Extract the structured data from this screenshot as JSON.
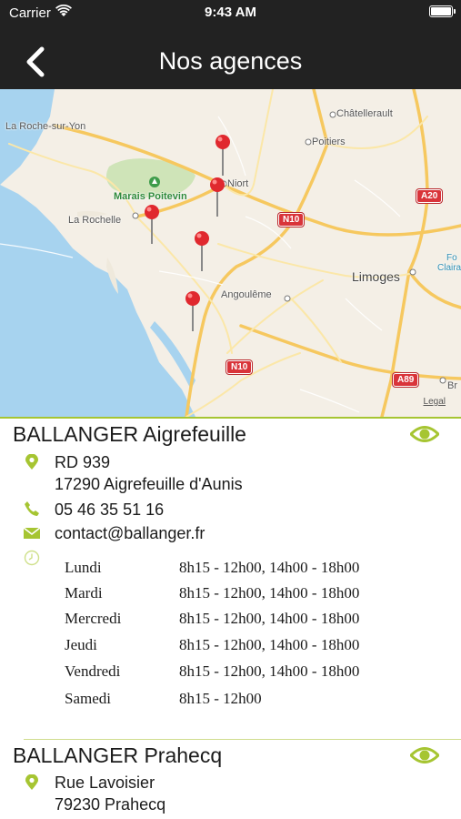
{
  "status_bar": {
    "carrier": "Carrier",
    "time": "9:43 AM"
  },
  "nav": {
    "title": "Nos agences",
    "back_icon": "chevron-left-icon"
  },
  "map": {
    "cities": {
      "la_roche_sur_yon": "La Roche-sur-Yon",
      "chatellerault": "Châtellerault",
      "poitiers": "Poitiers",
      "niort": "Niort",
      "marais_poitevin": "Marais Poitevin",
      "la_rochelle": "La Rochelle",
      "limoges": "Limoges",
      "angouleme": "Angoulême",
      "foret": "Fo",
      "claira": "Claira",
      "br": "Br"
    },
    "roads": {
      "a20": "A20",
      "n10_a": "N10",
      "n10_b": "N10",
      "a89": "A89"
    },
    "legal": "Legal",
    "pin_color": "#e0282e",
    "water_color": "#a7d3ef"
  },
  "accent_color": "#a6c532",
  "agencies": [
    {
      "name": "BALLANGER Aigrefeuille",
      "address_line1": "RD 939",
      "address_line2": "17290 Aigrefeuille d'Aunis",
      "phone": "05 46 35 51 16",
      "email": "contact@ballanger.fr",
      "hours": [
        {
          "day": "Lundi",
          "time": "8h15 - 12h00, 14h00 - 18h00"
        },
        {
          "day": "Mardi",
          "time": "8h15 - 12h00, 14h00 - 18h00"
        },
        {
          "day": "Mercredi",
          "time": "8h15 - 12h00, 14h00 - 18h00"
        },
        {
          "day": "Jeudi",
          "time": "8h15 - 12h00, 14h00 - 18h00"
        },
        {
          "day": "Vendredi",
          "time": "8h15 - 12h00, 14h00 - 18h00"
        },
        {
          "day": "Samedi",
          "time": "8h15 - 12h00"
        }
      ]
    },
    {
      "name": "BALLANGER Prahecq",
      "address_line1": "Rue Lavoisier",
      "address_line2": "79230 Prahecq"
    }
  ]
}
